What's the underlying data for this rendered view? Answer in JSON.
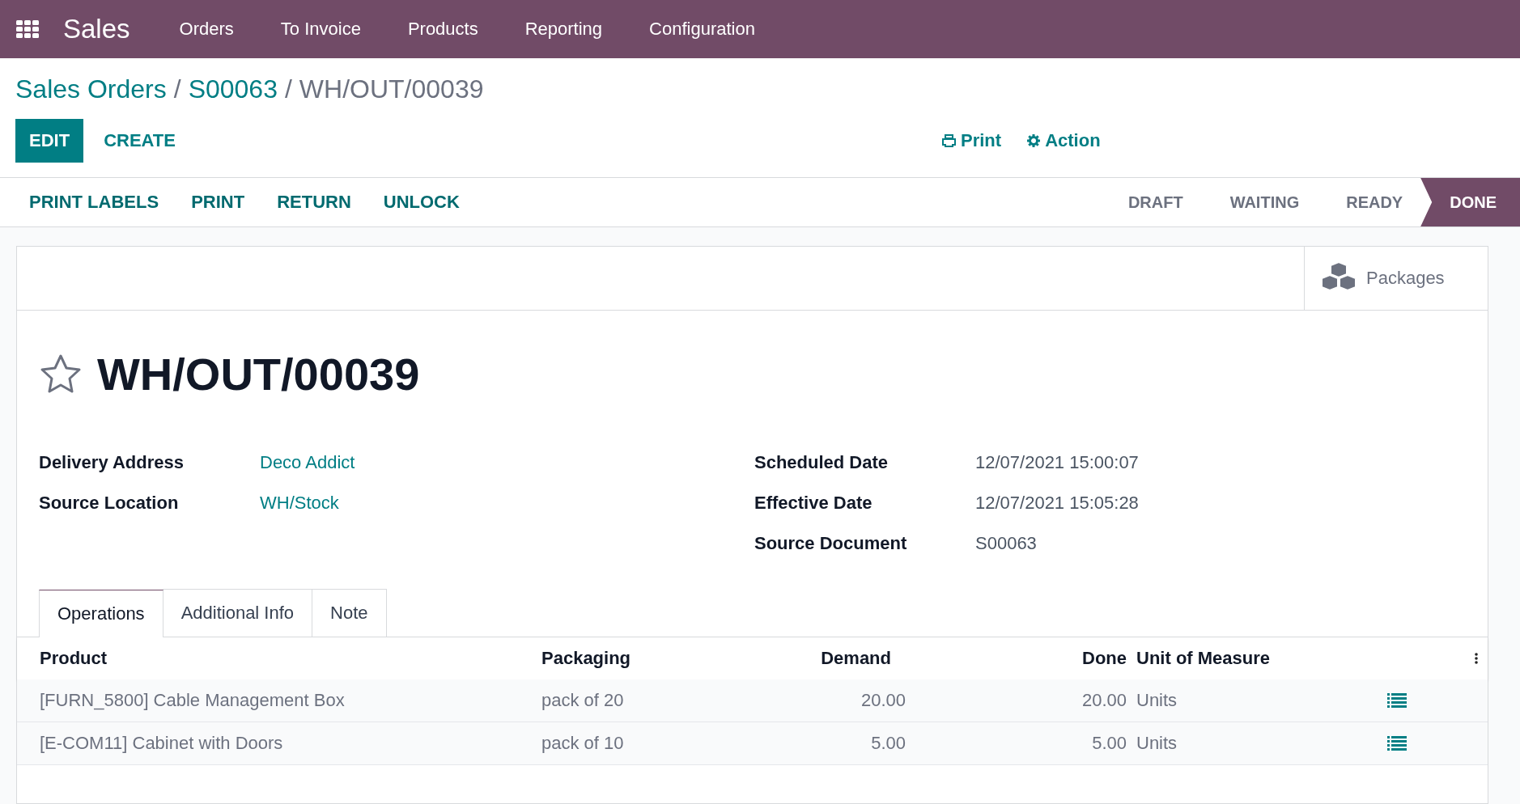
{
  "navbar": {
    "app_name": "Sales",
    "menu": [
      "Orders",
      "To Invoice",
      "Products",
      "Reporting",
      "Configuration"
    ]
  },
  "breadcrumb": [
    {
      "label": "Sales Orders",
      "link": true
    },
    {
      "label": "S00063",
      "link": true,
      "separator": "/"
    },
    {
      "label": "WH/OUT/00039",
      "link": false,
      "separator": "/"
    }
  ],
  "control_buttons": [
    {
      "label": "EDIT",
      "primary": true
    },
    {
      "label": "CREATE",
      "primary": false
    }
  ],
  "sidebar_actions": [
    {
      "label": "Print",
      "kind": "print"
    },
    {
      "label": "Action",
      "kind": "gear"
    }
  ],
  "header_buttons": [
    "PRINT LABELS",
    "PRINT",
    "RETURN",
    "UNLOCK"
  ],
  "statusbar": [
    {
      "label": "DRAFT",
      "selected": false
    },
    {
      "label": "WAITING",
      "selected": false
    },
    {
      "label": "READY",
      "selected": false
    },
    {
      "label": "DONE",
      "selected": true
    }
  ],
  "smart_button": {
    "label": "Packages"
  },
  "record": {
    "title": "WH/OUT/00039",
    "starred": false
  },
  "fields_left": [
    {
      "label": "Delivery Address",
      "value": "Deco Addict",
      "link": true
    },
    {
      "label": "Source Location",
      "value": "WH/Stock",
      "link": true
    }
  ],
  "fields_right": [
    {
      "label": "Scheduled Date",
      "value": "12/07/2021 15:00:07",
      "link": false
    },
    {
      "label": "Effective Date",
      "value": "12/07/2021 15:05:28",
      "link": false
    },
    {
      "label": "Source Document",
      "value": "S00063",
      "link": false
    }
  ],
  "tabs": [
    {
      "label": "Operations",
      "selected": true
    },
    {
      "label": "Additional Info",
      "selected": false
    },
    {
      "label": "Note",
      "selected": false
    }
  ],
  "table": {
    "columns": [
      "Product",
      "Packaging",
      "Demand",
      "Done",
      "Unit of Measure"
    ],
    "rows": [
      {
        "product": "[FURN_5800] Cable Management Box",
        "packaging": "pack of 20",
        "demand": "20.00",
        "done": "20.00",
        "uom": "Units"
      },
      {
        "product": "[E-COM11] Cabinet with Doors",
        "packaging": "pack of 10",
        "demand": "5.00",
        "done": "5.00",
        "uom": "Units"
      }
    ]
  }
}
